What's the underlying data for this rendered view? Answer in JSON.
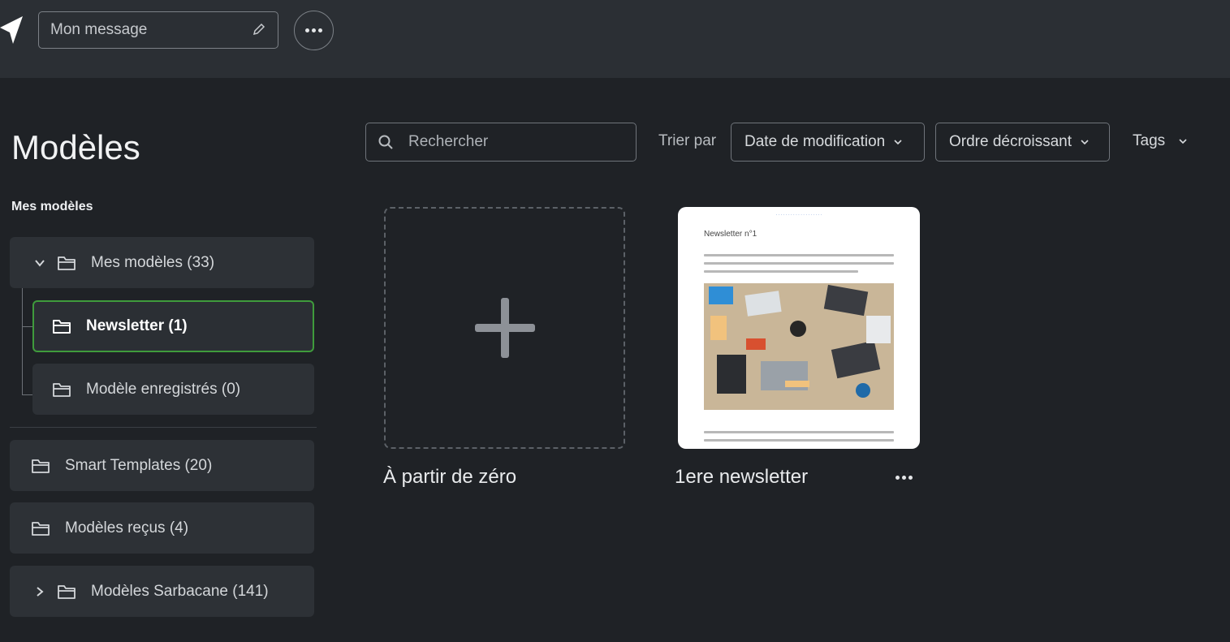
{
  "topbar": {
    "message_field": "Mon message"
  },
  "sidebar": {
    "title": "Modèles",
    "section_label": "Mes modèles",
    "folders": [
      {
        "label": "Mes modèles (33)"
      },
      {
        "label": "Newsletter (1)"
      },
      {
        "label": "Modèle enregistrés (0)"
      },
      {
        "label": "Smart Templates (20)"
      },
      {
        "label": "Modèles reçus (4)"
      },
      {
        "label": "Modèles Sarbacane (141)"
      }
    ]
  },
  "toolbar": {
    "search_placeholder": "Rechercher",
    "sort_label": "Trier par",
    "sort_field": "Date de modification",
    "sort_order": "Ordre décroissant",
    "tags_label": "Tags"
  },
  "cards": [
    {
      "label": "À partir de zéro"
    },
    {
      "label": "1ere newsletter",
      "preview_title": "Newsletter n°1"
    }
  ],
  "colors": {
    "background": "#1f2226",
    "topbar": "#2b2f34",
    "folder_bg": "#2d3136",
    "selected_border": "#3f9b3c"
  }
}
